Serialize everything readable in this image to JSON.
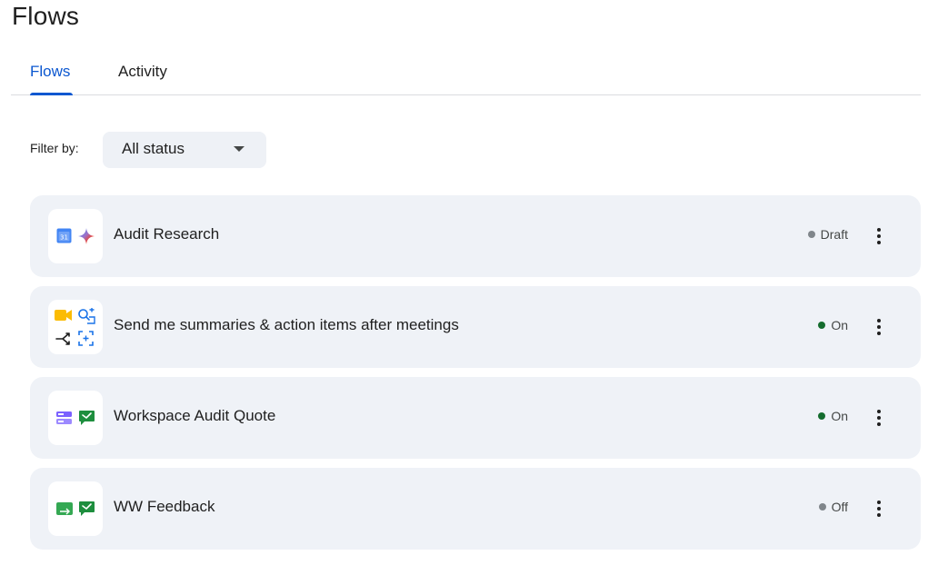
{
  "page": {
    "title": "Flows"
  },
  "tabs": [
    {
      "label": "Flows",
      "active": true
    },
    {
      "label": "Activity",
      "active": false
    }
  ],
  "filter": {
    "label": "Filter by:",
    "value": "All status"
  },
  "flows": [
    {
      "name": "Audit Research",
      "status": "Draft",
      "status_color": "#80868b",
      "icons": [
        "calendar-icon",
        "gemini-sparkle-icon"
      ]
    },
    {
      "name": "Send me summaries & action items after meetings",
      "status": "On",
      "status_color": "#146c2e",
      "icons": [
        "meet-icon",
        "search-agent-icon",
        "branch-icon",
        "screen-capture-icon"
      ]
    },
    {
      "name": "Workspace Audit Quote",
      "status": "On",
      "status_color": "#146c2e",
      "icons": [
        "form-icon",
        "chat-icon"
      ]
    },
    {
      "name": "WW Feedback",
      "status": "Off",
      "status_color": "#80868b",
      "icons": [
        "sheets-icon",
        "chat-icon"
      ]
    }
  ],
  "colors": {
    "accent": "#0b57d0",
    "card": "#eff2f7",
    "on": "#146c2e",
    "off": "#80868b"
  }
}
